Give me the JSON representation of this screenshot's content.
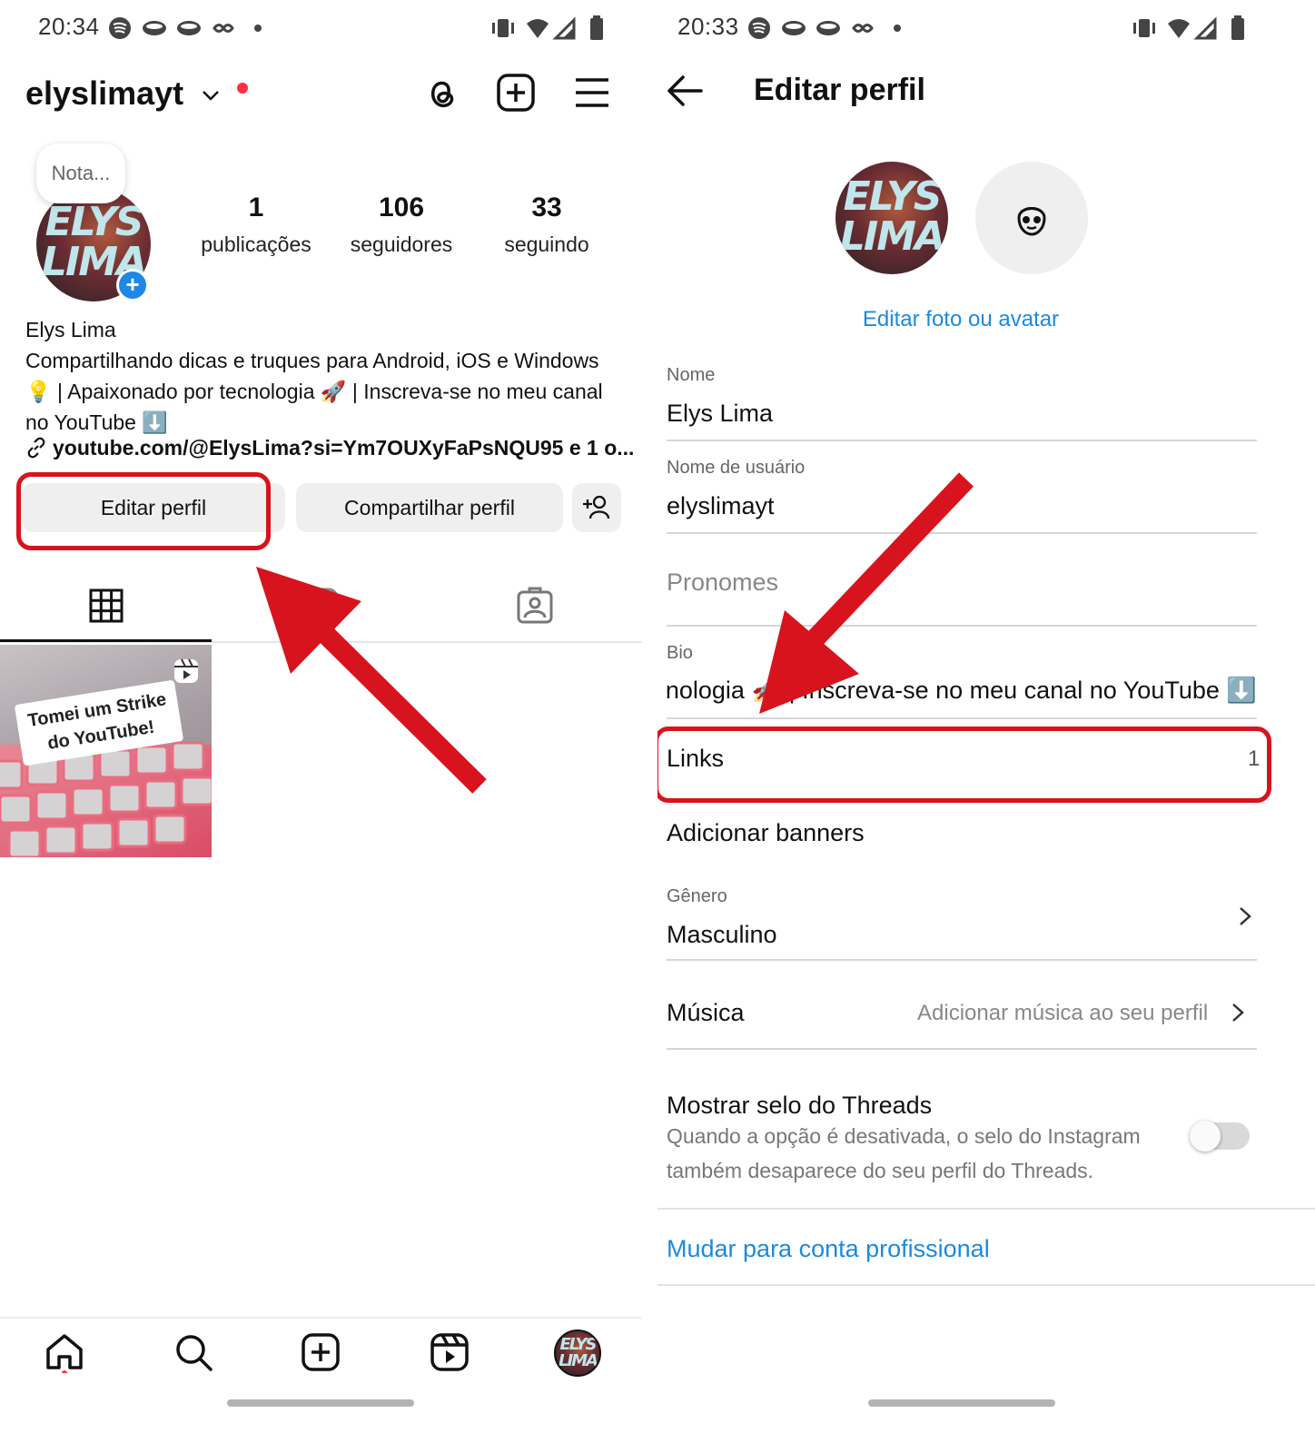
{
  "left": {
    "status": {
      "time": "20:34"
    },
    "header": {
      "username": "elyslimayt"
    },
    "note": "Nota...",
    "avatar": {
      "logo_line1": "ELYS",
      "logo_line2": "LIMA"
    },
    "stats": [
      {
        "value": "1",
        "label": "publicações"
      },
      {
        "value": "106",
        "label": "seguidores"
      },
      {
        "value": "33",
        "label": "seguindo"
      }
    ],
    "bio": {
      "name": "Elys Lima",
      "line1": "Compartilhando dicas e truques para Android, iOS e Windows",
      "line2": "💡 | Apaixonado por tecnologia 🚀 | Inscreva-se no meu canal",
      "line3": "no YouTube ⬇️",
      "link": "youtube.com/@ElysLima?si=Ym7OUXyFaPsNQU95 e 1 o..."
    },
    "buttons": {
      "edit": "Editar perfil",
      "share": "Compartilhar perfil"
    },
    "post": {
      "caption_line1": "Tomei um Strike",
      "caption_line2": "do YouTube!"
    }
  },
  "right": {
    "status": {
      "time": "20:33"
    },
    "title": "Editar perfil",
    "edit_photo": "Editar foto ou avatar",
    "fields": {
      "name_label": "Nome",
      "name_value": "Elys Lima",
      "username_label": "Nome de usuário",
      "username_value": "elyslimayt",
      "pronouns_placeholder": "Pronomes",
      "bio_label": "Bio",
      "bio_value": "tecnologia 🚀 | Inscreva-se no meu canal no YouTube ⬇️"
    },
    "links": {
      "label": "Links",
      "count": "1"
    },
    "banners": "Adicionar banners",
    "gender": {
      "label": "Gênero",
      "value": "Masculino"
    },
    "music": {
      "label": "Música",
      "hint": "Adicionar música ao seu perfil"
    },
    "threads": {
      "title": "Mostrar selo do Threads",
      "desc_line1": "Quando a opção é desativada, o selo do Instagram",
      "desc_line2": "também desaparece do seu perfil do Threads.",
      "enabled": false
    },
    "pro_link": "Mudar para conta profissional"
  },
  "colors": {
    "accent_blue": "#1a8ae0",
    "annotation_red": "#d7141d",
    "notification_dot": "#ff3040"
  }
}
